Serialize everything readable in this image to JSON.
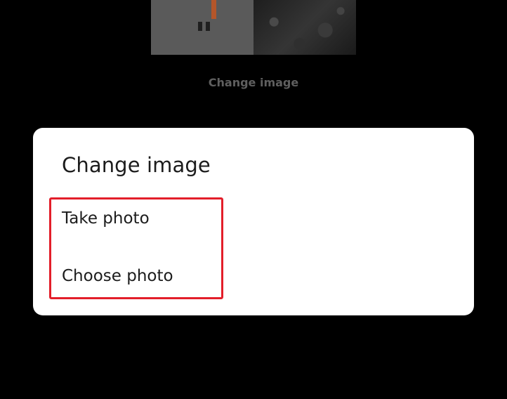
{
  "background": {
    "link_label": "Change image",
    "colors": {
      "screen": "#000000",
      "link_text": "#5f5f5f"
    }
  },
  "dialog": {
    "title": "Change image",
    "options": [
      {
        "label": "Take photo"
      },
      {
        "label": "Choose photo"
      }
    ],
    "colors": {
      "surface": "#ffffff",
      "text": "#1c1c1c"
    }
  },
  "annotation": {
    "highlight_color": "#e31e2a"
  }
}
